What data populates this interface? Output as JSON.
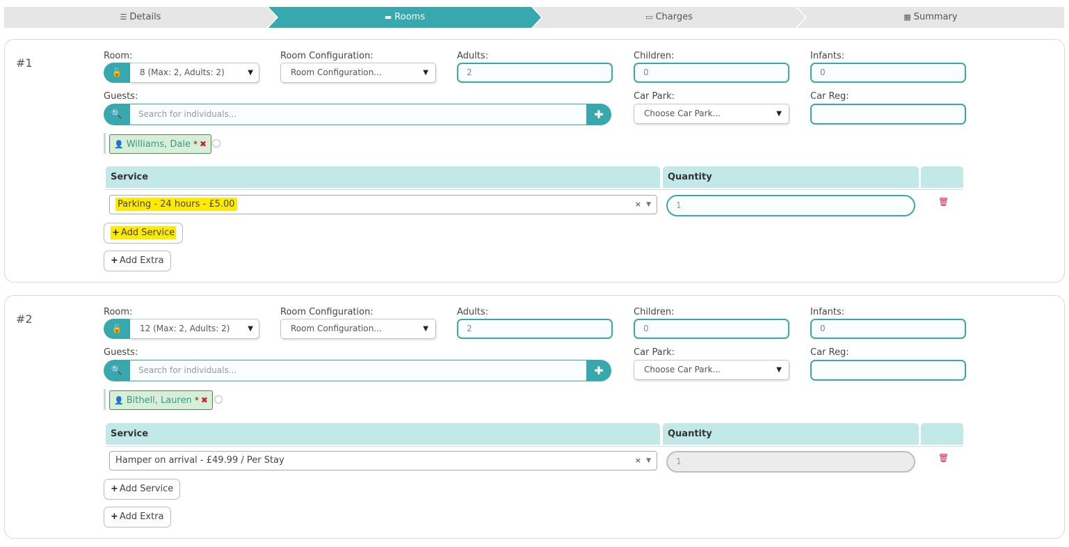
{
  "wizard": {
    "steps": [
      {
        "label": "Details",
        "icon": "list-icon",
        "glyph": "☰"
      },
      {
        "label": "Rooms",
        "icon": "bed-icon",
        "glyph": "▬"
      },
      {
        "label": "Charges",
        "icon": "credit-card-icon",
        "glyph": "▭"
      },
      {
        "label": "Summary",
        "icon": "grid-icon",
        "glyph": "▦"
      }
    ],
    "active": "Rooms"
  },
  "labels": {
    "room": "Room:",
    "room_config": "Room Configuration:",
    "adults": "Adults:",
    "children": "Children:",
    "infants": "Infants:",
    "guests": "Guests:",
    "car_park": "Car Park:",
    "car_reg": "Car Reg:",
    "service_header": "Service",
    "quantity_header": "Quantity",
    "add_service": "Add Service",
    "add_extra": "Add Extra"
  },
  "rooms": [
    {
      "number": "#1",
      "room_select": "8 (Max: 2, Adults: 2)",
      "room_config": "Room Configuration...",
      "adults": "2",
      "children": "0",
      "infants": "0",
      "guest_search_placeholder": "Search for individuals...",
      "car_park": "Choose Car Park...",
      "car_reg": "",
      "guest": {
        "name": "Williams, Dale",
        "star": "*",
        "remove": "✖"
      },
      "service": "Parking - 24 hours - £5.00",
      "quantity": "1"
    },
    {
      "number": "#2",
      "room_select": "12 (Max: 2, Adults: 2)",
      "room_config": "Room Configuration...",
      "adults": "2",
      "children": "0",
      "infants": "0",
      "guest_search_placeholder": "Search for individuals...",
      "car_park": "Choose Car Park...",
      "car_reg": "",
      "guest": {
        "name": "Bithell, Lauren",
        "star": "*",
        "remove": "✖"
      },
      "service": "Hamper on arrival - £49.99 / Per Stay",
      "quantity": "1"
    }
  ],
  "colors": {
    "accent": "#37a8ae",
    "table_header": "#c3e8e8",
    "highlight": "#ffea00",
    "delete": "#d0214a"
  }
}
